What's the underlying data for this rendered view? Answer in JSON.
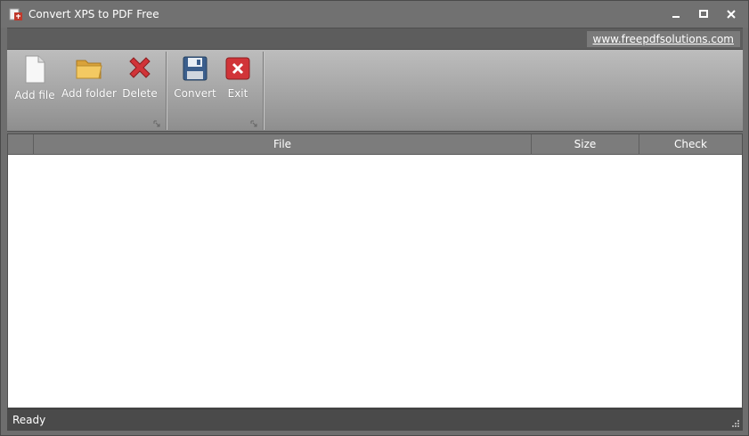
{
  "window": {
    "title": "Convert XPS to PDF Free",
    "icons": {
      "app": "xps-pdf-app-icon",
      "minimize": "minimize-icon",
      "maximize": "maximize-icon",
      "close": "close-icon"
    }
  },
  "linkbar": {
    "url_text": "www.freepdfsolutions.com"
  },
  "ribbon": {
    "files_group": [
      {
        "label": "Add file",
        "icon": "blank-document-icon"
      },
      {
        "label": "Add folder",
        "icon": "folder-icon"
      },
      {
        "label": "Delete",
        "icon": "red-x-icon"
      }
    ],
    "actions_group": [
      {
        "label": "Convert",
        "icon": "floppy-disk-icon"
      },
      {
        "label": "Exit",
        "icon": "exit-icon"
      }
    ]
  },
  "grid": {
    "columns": [
      "",
      "File",
      "Size",
      "Check"
    ],
    "rows": []
  },
  "status": {
    "text": "Ready"
  },
  "colors": {
    "accent_red": "#d13438",
    "floppy_blue": "#3b5e8c",
    "folder_yellow": "#e8b441"
  }
}
